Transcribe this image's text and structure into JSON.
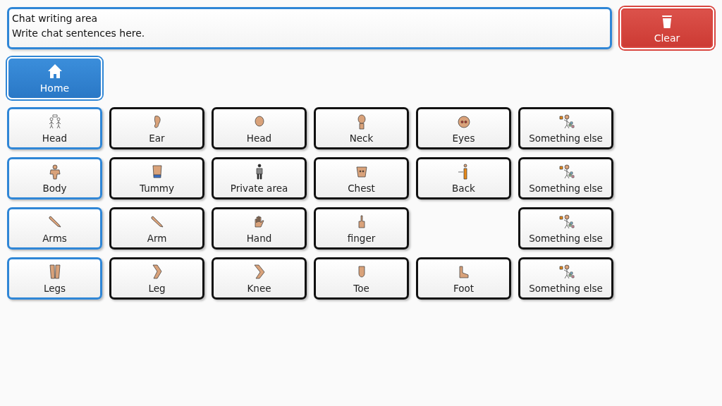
{
  "chat_field": {
    "lines": [
      "Chat writing area",
      "Write chat sentences here."
    ]
  },
  "clear_button": {
    "label": "Clear"
  },
  "home_button": {
    "label": "Home"
  },
  "rows": [
    {
      "category": {
        "label": "Head"
      },
      "words": [
        {
          "label": "Ear"
        },
        {
          "label": "Head"
        },
        {
          "label": "Neck"
        },
        {
          "label": "Eyes"
        }
      ],
      "more": {
        "label": "Something else"
      }
    },
    {
      "category": {
        "label": "Body"
      },
      "words": [
        {
          "label": "Tummy"
        },
        {
          "label": "Private area"
        },
        {
          "label": "Chest"
        },
        {
          "label": "Back"
        }
      ],
      "more": {
        "label": "Something else"
      }
    },
    {
      "category": {
        "label": "Arms"
      },
      "words": [
        {
          "label": "Arm"
        },
        {
          "label": "Hand"
        },
        {
          "label": "finger"
        }
      ],
      "more": {
        "label": "Something else"
      }
    },
    {
      "category": {
        "label": "Legs"
      },
      "words": [
        {
          "label": "Leg"
        },
        {
          "label": "Knee"
        },
        {
          "label": "Toe"
        },
        {
          "label": "Foot"
        }
      ],
      "more": {
        "label": "Something else"
      }
    }
  ]
}
